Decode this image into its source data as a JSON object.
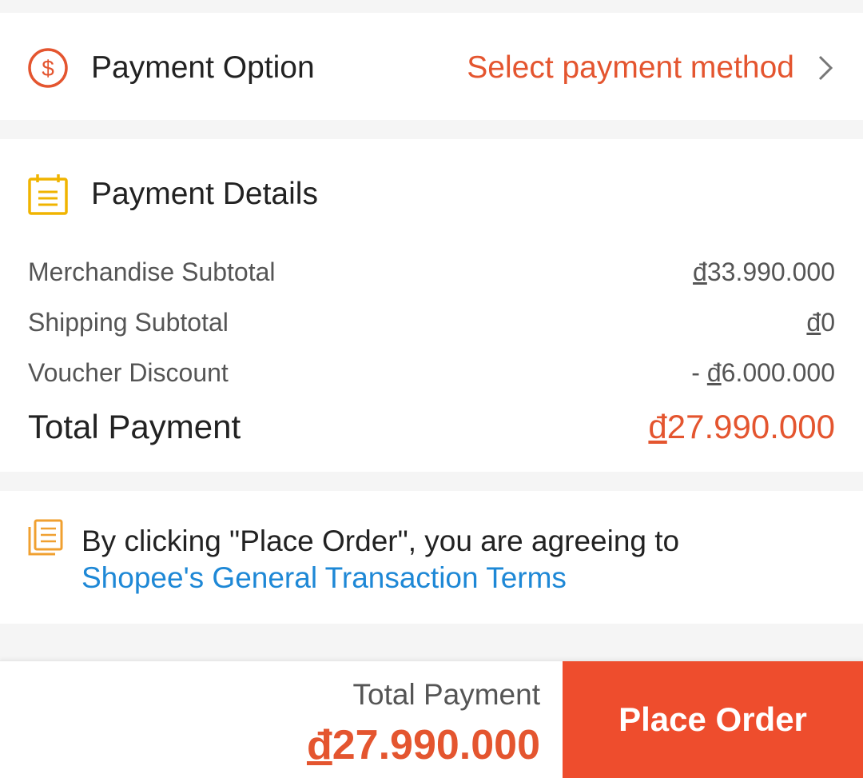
{
  "payment_option": {
    "icon": "dollar-circle-icon",
    "title": "Payment Option",
    "value": "Select payment method",
    "chevron_icon": "chevron-right-icon"
  },
  "payment_details": {
    "icon": "calendar-note-icon",
    "title": "Payment Details",
    "rows": [
      {
        "label": "Merchandise Subtotal",
        "value_prefix": "",
        "currency": "đ",
        "amount": "33.990.000"
      },
      {
        "label": "Shipping Subtotal",
        "value_prefix": "",
        "currency": "đ",
        "amount": "0"
      },
      {
        "label": "Voucher Discount",
        "value_prefix": "- ",
        "currency": "đ",
        "amount": "6.000.000"
      }
    ],
    "total": {
      "label": "Total Payment",
      "currency": "đ",
      "amount": "27.990.000"
    }
  },
  "terms": {
    "icon": "document-icon",
    "text": "By clicking \"Place Order\", you are agreeing to ",
    "link": "Shopee's General Transaction Terms"
  },
  "bottom_bar": {
    "label": "Total Payment",
    "currency": "đ",
    "amount": "27.990.000",
    "button": "Place Order"
  },
  "colors": {
    "accent": "#ee4d2d",
    "price": "#e4552f",
    "link": "#1e88d6",
    "details_icon": "#f0b400"
  }
}
